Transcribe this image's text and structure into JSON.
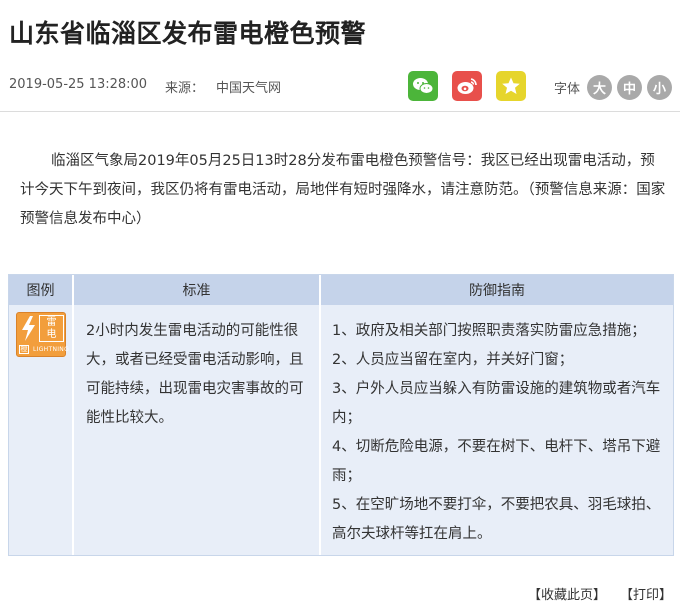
{
  "article": {
    "title": "山东省临淄区发布雷电橙色预警",
    "date": "2019-05-25 13:28:00",
    "source_label": "来源：",
    "source_name": "中国天气网",
    "body": "临淄区气象局2019年05月25日13时28分发布雷电橙色预警信号：我区已经出现雷电活动，预计今天下午到夜间，我区仍将有雷电活动，局地伴有短时强降水，请注意防范。（预警信息来源：国家预警信息发布中心）"
  },
  "share": {
    "icons": [
      "wechat-icon",
      "weibo-icon",
      "star-icon"
    ],
    "colors": {
      "wechat": "#4cb53a",
      "weibo": "#e8504b",
      "favorite": "#e6d52c"
    }
  },
  "font_size": {
    "label": "字体",
    "large": "大",
    "medium": "中",
    "small": "小"
  },
  "table": {
    "headers": {
      "icon": "图例",
      "standard": "标准",
      "guide": "防御指南"
    },
    "warning_icon": {
      "chars": [
        "雷",
        "电"
      ],
      "level": "橙",
      "english": "LIGHTNING",
      "color": "#f29e3c"
    },
    "standard": "2小时内发生雷电活动的可能性很大，或者已经受雷电活动影响，且可能持续，出现雷电灾害事故的可能性比较大。",
    "guide": [
      "1、政府及相关部门按照职责落实防雷应急措施；",
      "2、人员应当留在室内，并关好门窗；",
      "3、户外人员应当躲入有防雷设施的建筑物或者汽车内；",
      "4、切断危险电源，不要在树下、电杆下、塔吊下避雨；",
      "5、在空旷场地不要打伞，不要把农具、羽毛球拍、高尔夫球杆等扛在肩上。"
    ]
  },
  "footer": {
    "bookmark": "【收藏此页】",
    "print": "【打印】"
  }
}
